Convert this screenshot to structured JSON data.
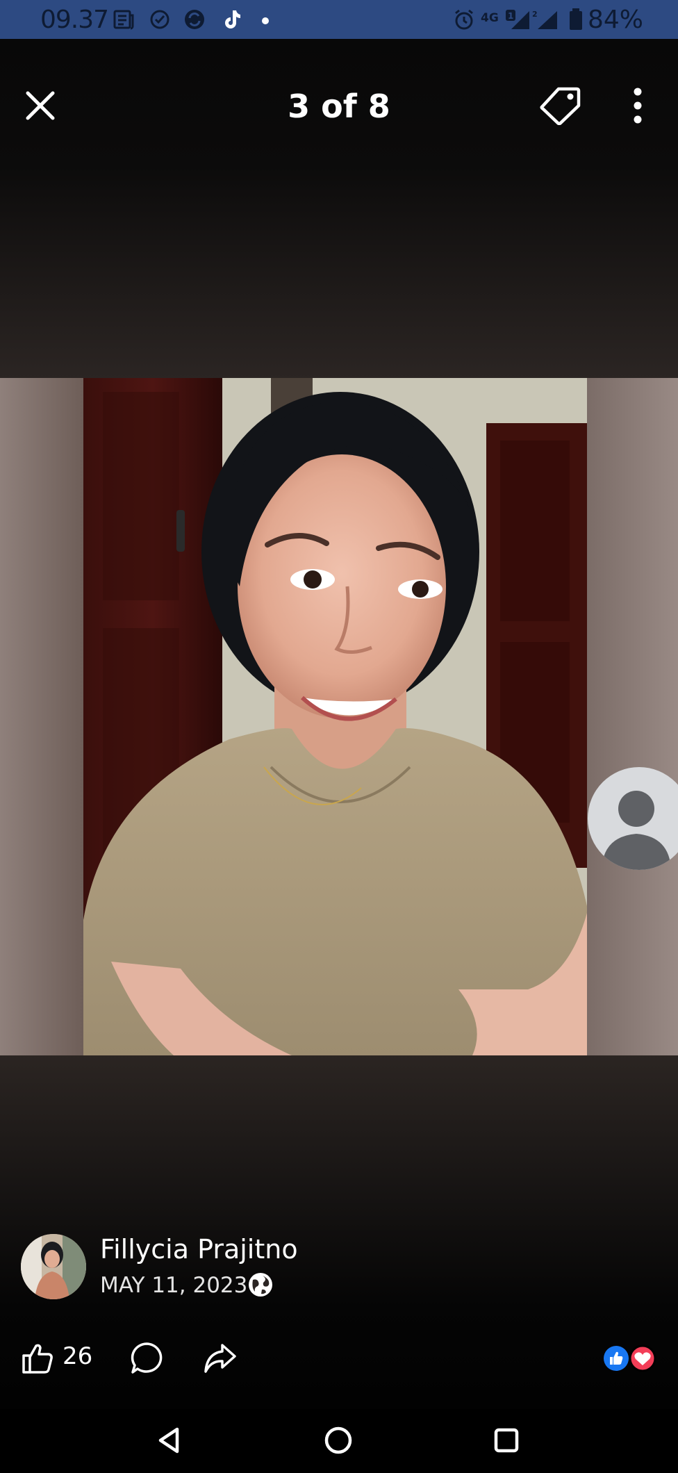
{
  "status_bar": {
    "time": "09.37",
    "network": "4G",
    "sim1_badge": "1",
    "sim2_badge": "2",
    "battery": "84%",
    "icons": [
      "news-icon",
      "check-circle-icon",
      "data-saver-icon",
      "tiktok-icon",
      "notification-dot-icon",
      "alarm-icon",
      "signal-icon",
      "battery-icon"
    ]
  },
  "header": {
    "counter": "3 of 8",
    "icons": [
      "close-icon",
      "tag-icon",
      "more-options-icon"
    ]
  },
  "post": {
    "author_name": "Fillycia Prajitno",
    "date": "MAY 11, 2023",
    "privacy_icon": "globe-icon"
  },
  "actions": {
    "like_count": "26",
    "icons": [
      "like-icon",
      "comment-icon",
      "share-icon"
    ],
    "reactions": [
      "like-reaction-icon",
      "love-reaction-icon"
    ]
  },
  "nav": {
    "icons": [
      "back-icon",
      "home-icon",
      "recents-icon"
    ]
  },
  "colors": {
    "status_bar_bg": "#2d4a82",
    "like_blue": "#1877f2",
    "love_red": "#f33e58",
    "text_white": "#ffffff"
  }
}
